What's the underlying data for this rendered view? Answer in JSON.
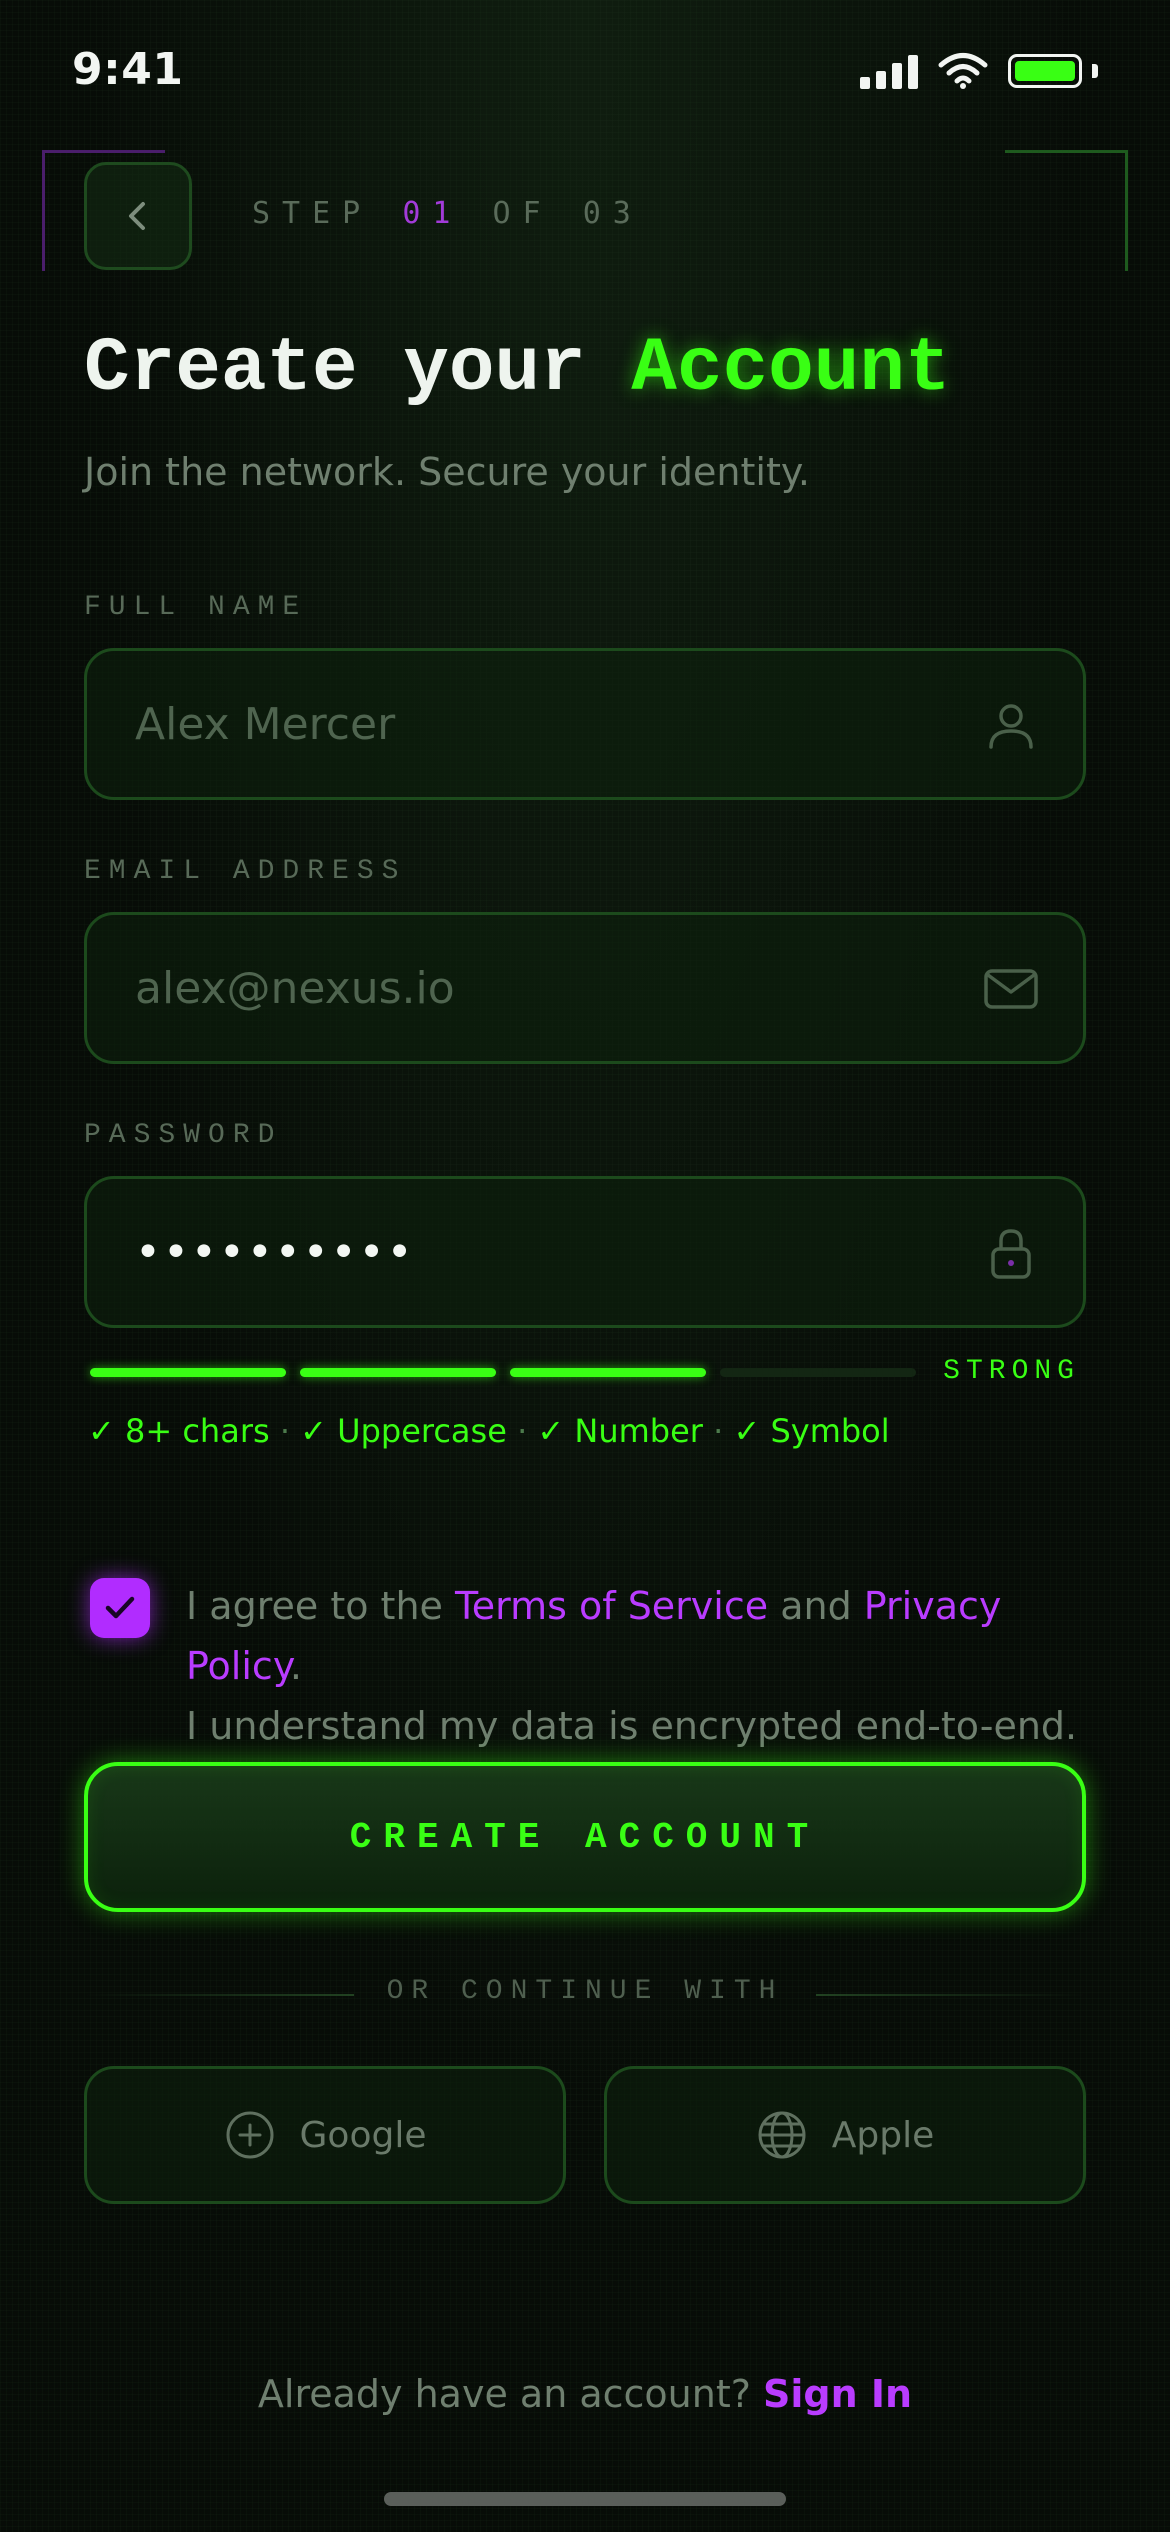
{
  "status_bar": {
    "time": "9:41",
    "icons": [
      "signal-icon",
      "wifi-icon",
      "battery-icon"
    ],
    "battery_color": "#39ff14"
  },
  "header": {
    "back_icon": "chevron-left-icon",
    "step_prefix": "STEP",
    "step_current": "01",
    "step_of": "OF",
    "step_total": "03"
  },
  "title": {
    "part1": "Create your",
    "accent": "Account"
  },
  "subtitle": "Join the network. Secure your identity.",
  "form": {
    "full_name": {
      "label": "FULL NAME",
      "placeholder": "Alex Mercer",
      "icon": "user-icon"
    },
    "email": {
      "label": "EMAIL ADDRESS",
      "placeholder": "alex@nexus.io",
      "icon": "mail-icon"
    },
    "password": {
      "label": "PASSWORD",
      "value": "••••••••••",
      "icon": "lock-icon"
    },
    "strength": {
      "segments_filled": 3,
      "segments_total": 4,
      "label": "STRONG"
    },
    "requirements": [
      "✓ 8+ chars",
      "✓ Uppercase",
      "✓ Number",
      "✓ Symbol"
    ],
    "requirements_separator": "·"
  },
  "agreement": {
    "checked": true,
    "prefix": "I agree to the ",
    "terms_link": "Terms of Service",
    "middle": " and ",
    "privacy_link": "Privacy Policy",
    "suffix": ".",
    "line2": "I understand my data is encrypted end-to-end."
  },
  "primary_button": "CREATE ACCOUNT",
  "divider": "OR CONTINUE WITH",
  "social": {
    "google": {
      "label": "Google",
      "icon": "plus-circle-icon"
    },
    "apple": {
      "label": "Apple",
      "icon": "globe-icon"
    }
  },
  "footer": {
    "prompt": "Already have an account?",
    "link": "Sign In"
  },
  "colors": {
    "accent_green": "#39ff14",
    "accent_purple": "#b93cff",
    "background": "#070c07"
  }
}
